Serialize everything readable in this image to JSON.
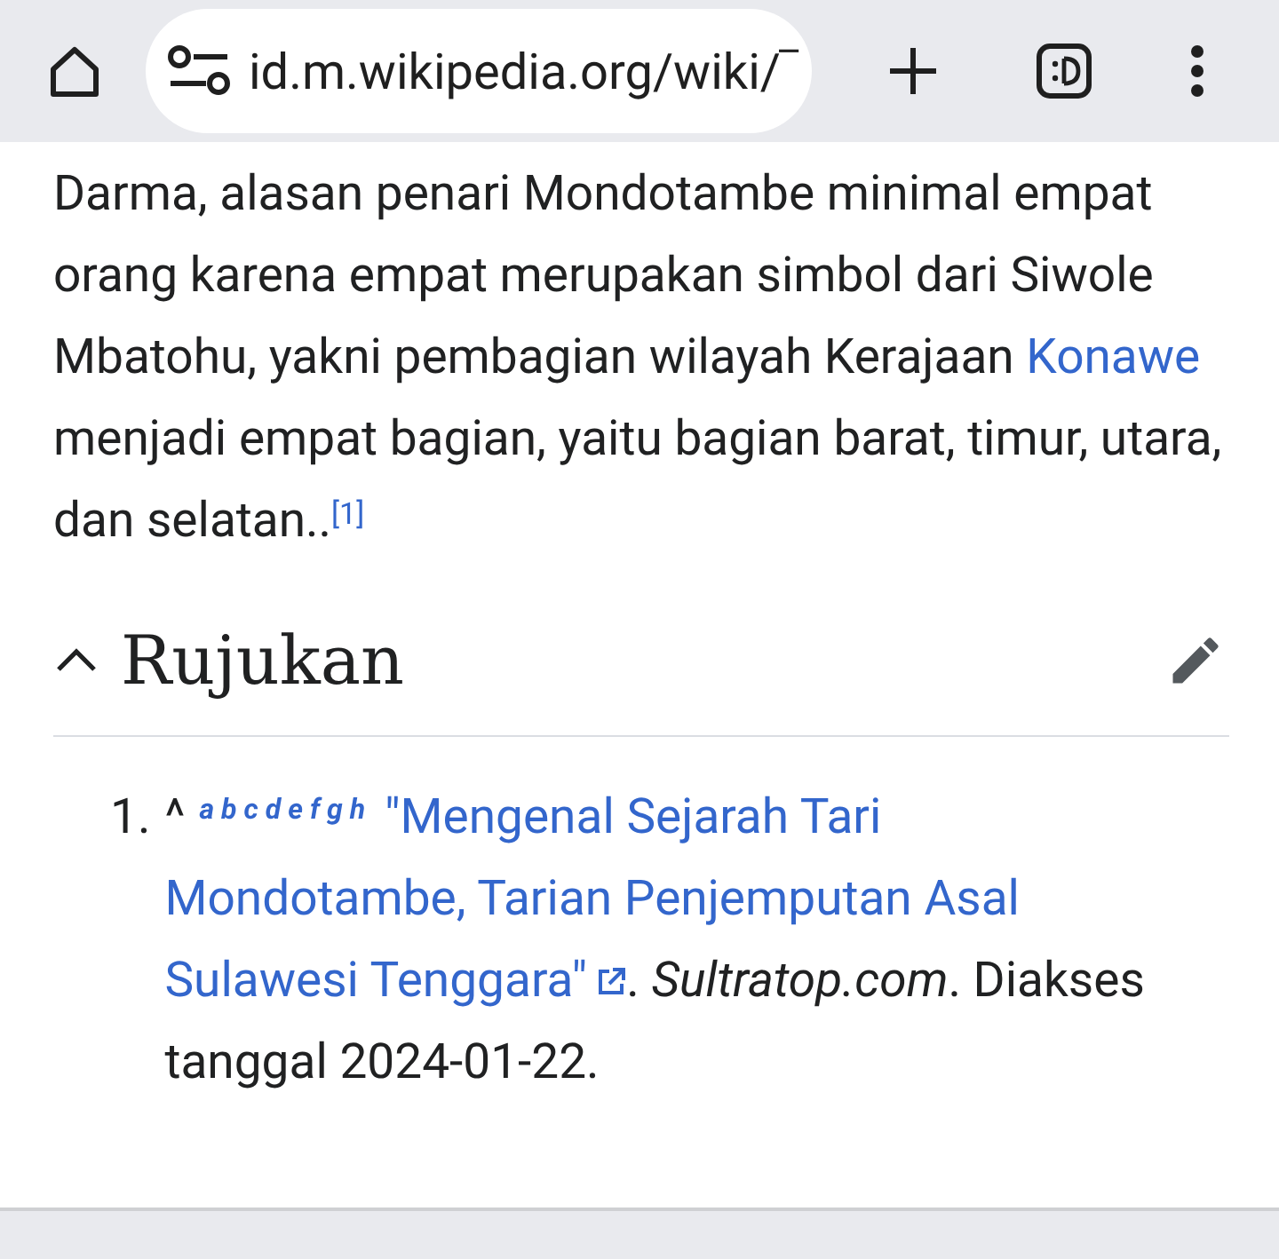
{
  "toolbar": {
    "url": "id.m.wikipedia.org/wiki/‾"
  },
  "paragraph": {
    "before": "Darma, alasan penari Mondotambe minimal empat orang karena empat merupakan simbol dari Siwole Mbatohu, yakni pembagian wilayah Kerajaan ",
    "link": "Konawe",
    "after": " menjadi empat bagian, yaitu bagian barat, timur, utara, dan selatan..",
    "footnote": "[1]"
  },
  "section": {
    "title": "Rujukan",
    "expanded": true
  },
  "references": [
    {
      "number": "1.",
      "caret": "^",
      "backlinks": [
        "a",
        "b",
        "c",
        "d",
        "e",
        "f",
        "g",
        "h"
      ],
      "title_lines": [
        "\"Mengenal Sejarah Tari",
        "Mondotambe, Tarian Penjemputan Asal",
        "Sulawesi Tenggara\""
      ],
      "sep": ". ",
      "publisher": "Sultratop.com",
      "accessed": ". Diakses tanggal 2024-01-22."
    }
  ]
}
